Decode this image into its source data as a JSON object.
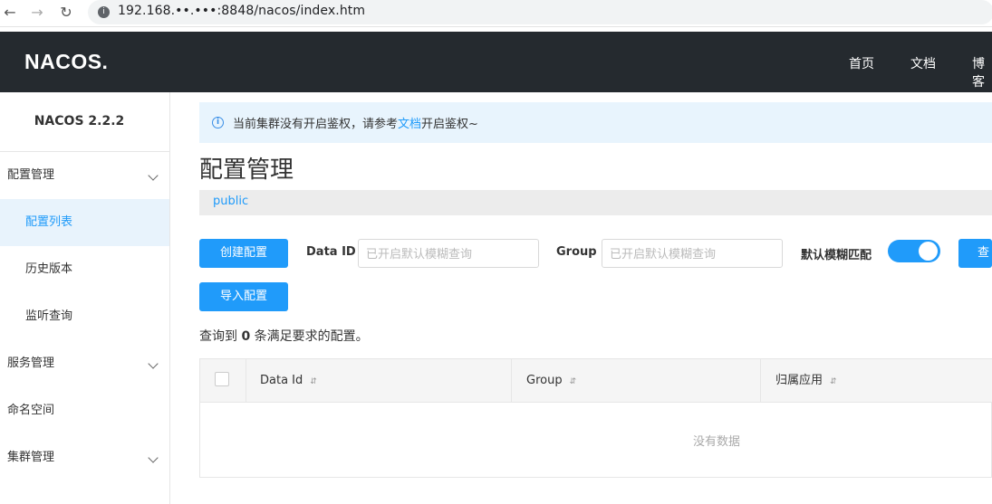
{
  "browser": {
    "url": "192.168.••.•••:8848/nacos/index.htm"
  },
  "header": {
    "logo": "NACOS.",
    "nav": [
      "首页",
      "文档",
      "博客"
    ]
  },
  "sidebar": {
    "version": "NACOS 2.2.2",
    "items": [
      {
        "label": "配置管理",
        "expandable": true
      },
      {
        "label": "配置列表",
        "active": true
      },
      {
        "label": "历史版本"
      },
      {
        "label": "监听查询"
      },
      {
        "label": "服务管理",
        "expandable": true
      },
      {
        "label": "命名空间"
      },
      {
        "label": "集群管理",
        "expandable": true
      }
    ]
  },
  "notice": {
    "prefix": "当前集群没有开启鉴权，请参考",
    "link": "文档",
    "suffix": "开启鉴权~"
  },
  "main": {
    "title": "配置管理",
    "namespace": "public",
    "create_button": "创建配置",
    "import_button": "导入配置",
    "data_id_label": "Data ID",
    "data_id_placeholder": "已开启默认模糊查询",
    "group_label": "Group",
    "group_placeholder": "已开启默认模糊查询",
    "fuzzy_label": "默认模糊匹配",
    "fuzzy_enabled": true,
    "query_button": "查询",
    "result_prefix": "查询到",
    "result_count": "0",
    "result_suffix": "条满足要求的配置。"
  },
  "table": {
    "columns": [
      "Data Id",
      "Group",
      "归属应用"
    ],
    "empty_text": "没有数据",
    "rows": []
  },
  "colors": {
    "primary": "#209bfa",
    "header_bg": "#252a2f",
    "notice_bg": "#e8f4fd"
  }
}
